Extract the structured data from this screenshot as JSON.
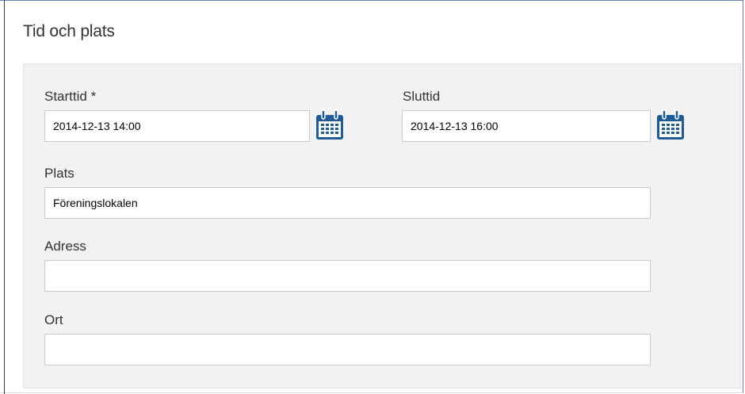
{
  "section": {
    "title": "Tid och plats"
  },
  "form": {
    "start": {
      "label": "Starttid *",
      "value": "2014-12-13 14:00"
    },
    "end": {
      "label": "Sluttid",
      "value": "2014-12-13 16:00"
    },
    "place": {
      "label": "Plats",
      "value": "Föreningslokalen"
    },
    "address": {
      "label": "Adress",
      "value": ""
    },
    "city": {
      "label": "Ort",
      "value": ""
    }
  },
  "icons": {
    "calendar": "calendar-icon"
  },
  "colors": {
    "calendar_icon": "#1f5c97",
    "panel_background": "#f2f2f2",
    "input_border": "#c9c9c9"
  }
}
